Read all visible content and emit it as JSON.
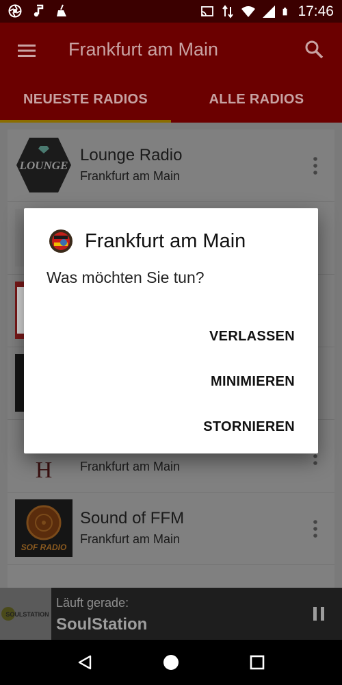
{
  "status_bar": {
    "time": "17:46",
    "left_icons": [
      "aperture-icon",
      "music-note-icon",
      "broom-icon"
    ],
    "right_icons": [
      "cast-icon",
      "data-arrows-icon",
      "wifi-icon",
      "cell-signal-icon",
      "battery-icon"
    ]
  },
  "app_bar": {
    "title": "Frankfurt am Main",
    "menu_icon": "hamburger-menu-icon",
    "search_icon": "search-icon",
    "tabs": [
      {
        "label": "NEUESTE RADIOS",
        "active": true
      },
      {
        "label": "ALLE RADIOS",
        "active": false
      }
    ]
  },
  "radio_list": [
    {
      "name": "Lounge Radio",
      "location": "Frankfurt am Main",
      "logo_text": "LOUNGE"
    },
    {
      "name": "",
      "location": "",
      "logo_text": ""
    },
    {
      "name": "",
      "location": "",
      "logo_text": ""
    },
    {
      "name": "",
      "location": "",
      "logo_text": ""
    },
    {
      "name": "",
      "location": "Frankfurt am Main",
      "logo_text": "H"
    },
    {
      "name": "Sound of FFM",
      "location": "Frankfurt am Main",
      "logo_text": "SOF RADIO"
    }
  ],
  "player": {
    "label": "Läuft gerade:",
    "station": "SoulStation",
    "art_text": "SOULSTATION",
    "pause_icon": "pause-icon"
  },
  "dialog": {
    "title": "Frankfurt am Main",
    "message": "Was möchten Sie tun?",
    "buttons": {
      "leave": "VERLASSEN",
      "minimize": "MINIMIEREN",
      "cancel": "STORNIEREN"
    }
  },
  "nav_bar": {
    "icons": [
      "back-icon",
      "home-icon",
      "recents-icon"
    ]
  },
  "colors": {
    "app_bar": "#6b0000",
    "status_bar": "#3b0000",
    "tab_indicator": "#8a6d00",
    "scrim_list": "#808080"
  }
}
